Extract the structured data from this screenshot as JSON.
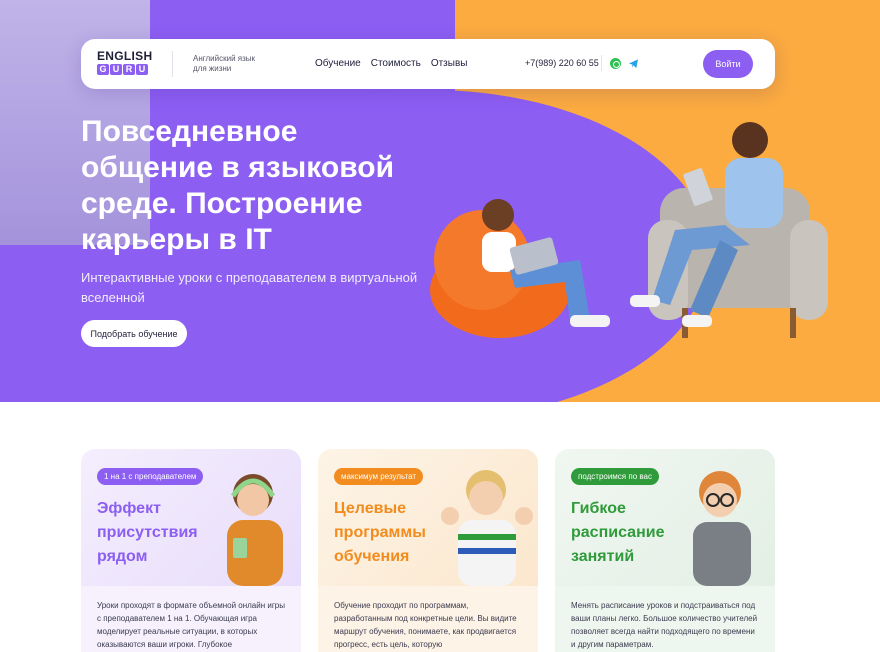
{
  "colors": {
    "primary": "#8c5ef2",
    "accent_orange": "#fbab3f",
    "green": "#2f9b3a",
    "whatsapp": "#2fc252",
    "telegram": "#2aa3e6"
  },
  "nav": {
    "logo_top": "ENGLISH",
    "logo_bottom": [
      "G",
      "U",
      "R",
      "U"
    ],
    "tagline": "Английский язык для жизни",
    "links": [
      "Обучение",
      "Стоимость",
      "Отзывы"
    ],
    "phone": "+7(989) 220 60 55",
    "icons": [
      "whatsapp-icon",
      "telegram-icon"
    ],
    "login_label": "Войти"
  },
  "hero": {
    "title": "Повседневное общение в языковой среде. Построение карьеры в IT",
    "subtitle": "Интерактивные уроки с преподавателем в виртуальной вселенной",
    "cta_label": "Подобрать обучение"
  },
  "cards": [
    {
      "badge": "1 на 1 с преподавателем",
      "title": "Эффект присутствия рядом",
      "text": "Уроки проходят в формате объемной онлайн игры с преподавателем 1 на 1. Обучающая игра моделирует реальные ситуации, в которых оказываются ваши игроки. Глубокое"
    },
    {
      "badge": "максимум результат",
      "title": "Целевые программы обучения",
      "text": "Обучение проходит по программам, разработанным под конкретные цели. Вы видите маршрут обучения, понимаете, как продвигается прогресс, есть цель, которую"
    },
    {
      "badge": "подстроимся по вас",
      "title": "Гибкое расписание занятий",
      "text": "Менять расписание уроков и подстраиваться под ваши планы легко. Большое количество учителей позволяет всегда найти подходящего по времени и другим параметрам."
    }
  ]
}
